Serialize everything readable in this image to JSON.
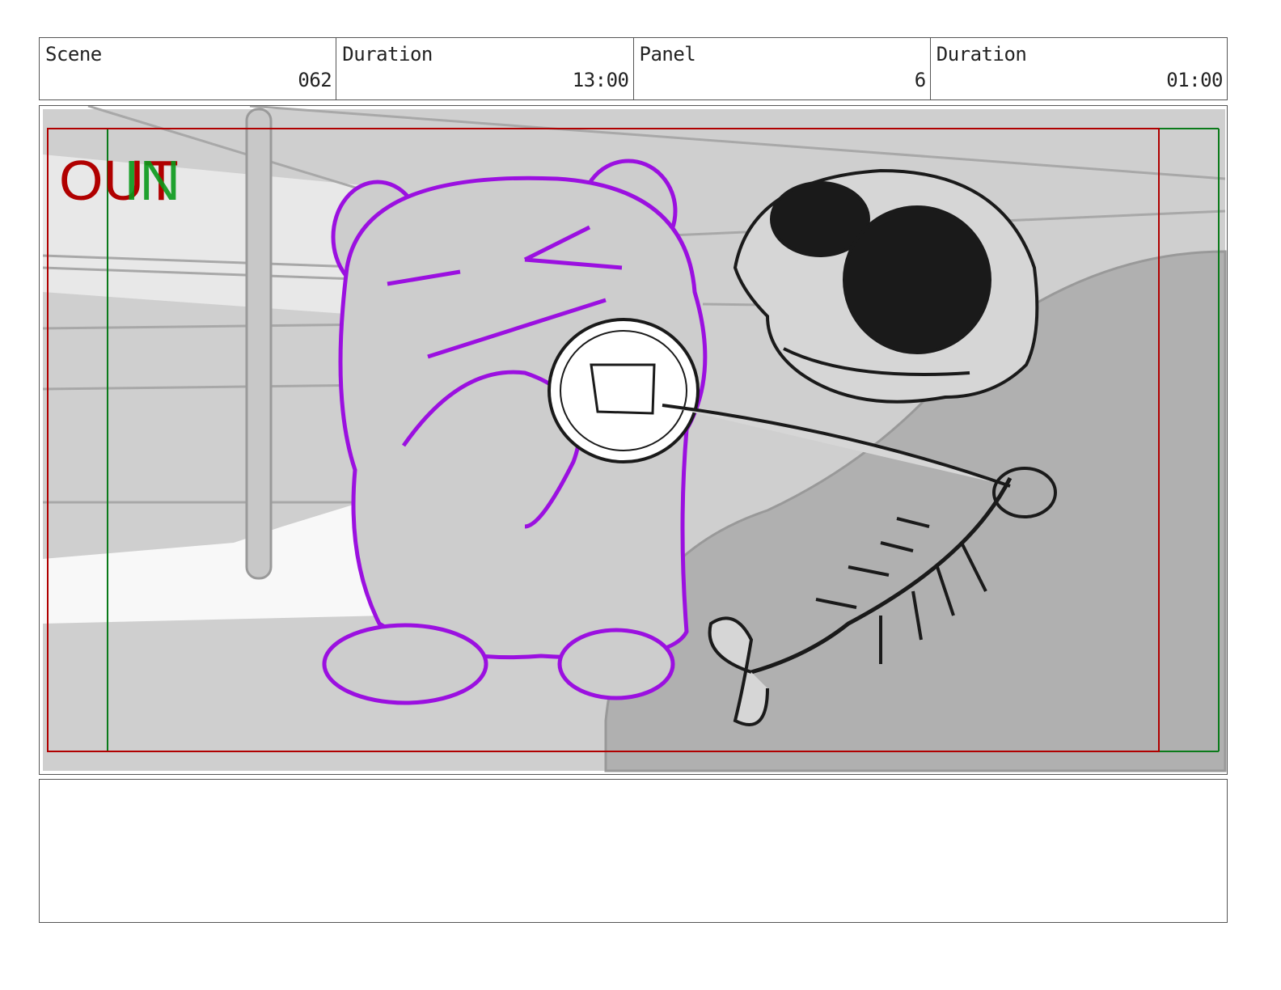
{
  "header": {
    "cells": [
      {
        "label": "Scene",
        "value": "062"
      },
      {
        "label": "Duration",
        "value": "13:00"
      },
      {
        "label": "Panel",
        "value": "6"
      },
      {
        "label": "Duration",
        "value": "01:00"
      }
    ]
  },
  "panel": {
    "overlay_out": "OUT",
    "overlay_in": "IN",
    "colors": {
      "out_frame": "#b00000",
      "in_frame": "#0a7a1a",
      "character_outline": "#9b10e0",
      "background_gray": "#cccccc"
    }
  },
  "notes": {
    "text": ""
  }
}
